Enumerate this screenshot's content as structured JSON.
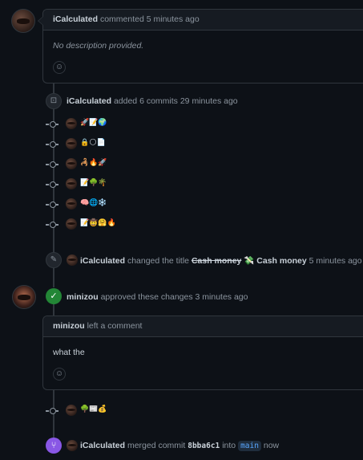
{
  "comment1": {
    "author": "iCalculated",
    "action": "commented",
    "time": "5 minutes ago",
    "body": "No description provided."
  },
  "commits_event": {
    "author": "iCalculated",
    "action": "added 6 commits",
    "time": "29 minutes ago",
    "commits": [
      {
        "message": "🚀📝🌍"
      },
      {
        "message": "🔒🌕📄"
      },
      {
        "message": "🦂🔥🚀"
      },
      {
        "message": "📝🌳🌴"
      },
      {
        "message": "🧠🌐❄️"
      },
      {
        "message": "📝🤠🤗🔥"
      }
    ]
  },
  "title_change": {
    "author": "iCalculated",
    "action": "changed the title",
    "old_title": "Cash money",
    "separator": "💸",
    "new_title": "Cash money",
    "time": "5 minutes ago"
  },
  "review": {
    "author": "minizou",
    "action": "approved these changes",
    "time": "3 minutes ago"
  },
  "review_comment": {
    "author": "minizou",
    "action": "left a comment",
    "body": "what the"
  },
  "late_commit": {
    "message": "🌳📰💰"
  },
  "merge": {
    "author": "iCalculated",
    "action": "merged commit",
    "sha": "8bba6c1",
    "into": "into",
    "branch": "main",
    "time": "now"
  },
  "icons": {
    "smiley": "smiley-icon",
    "push": "repo-push-icon",
    "commit": "git-commit-icon",
    "pencil": "pencil-icon",
    "check": "check-icon",
    "merge": "git-merge-icon"
  },
  "colors": {
    "background": "#0d1117",
    "card_header": "#161b22",
    "border": "#30363d",
    "approved": "#238636",
    "merged": "#8957e5",
    "link": "#58a6ff"
  }
}
